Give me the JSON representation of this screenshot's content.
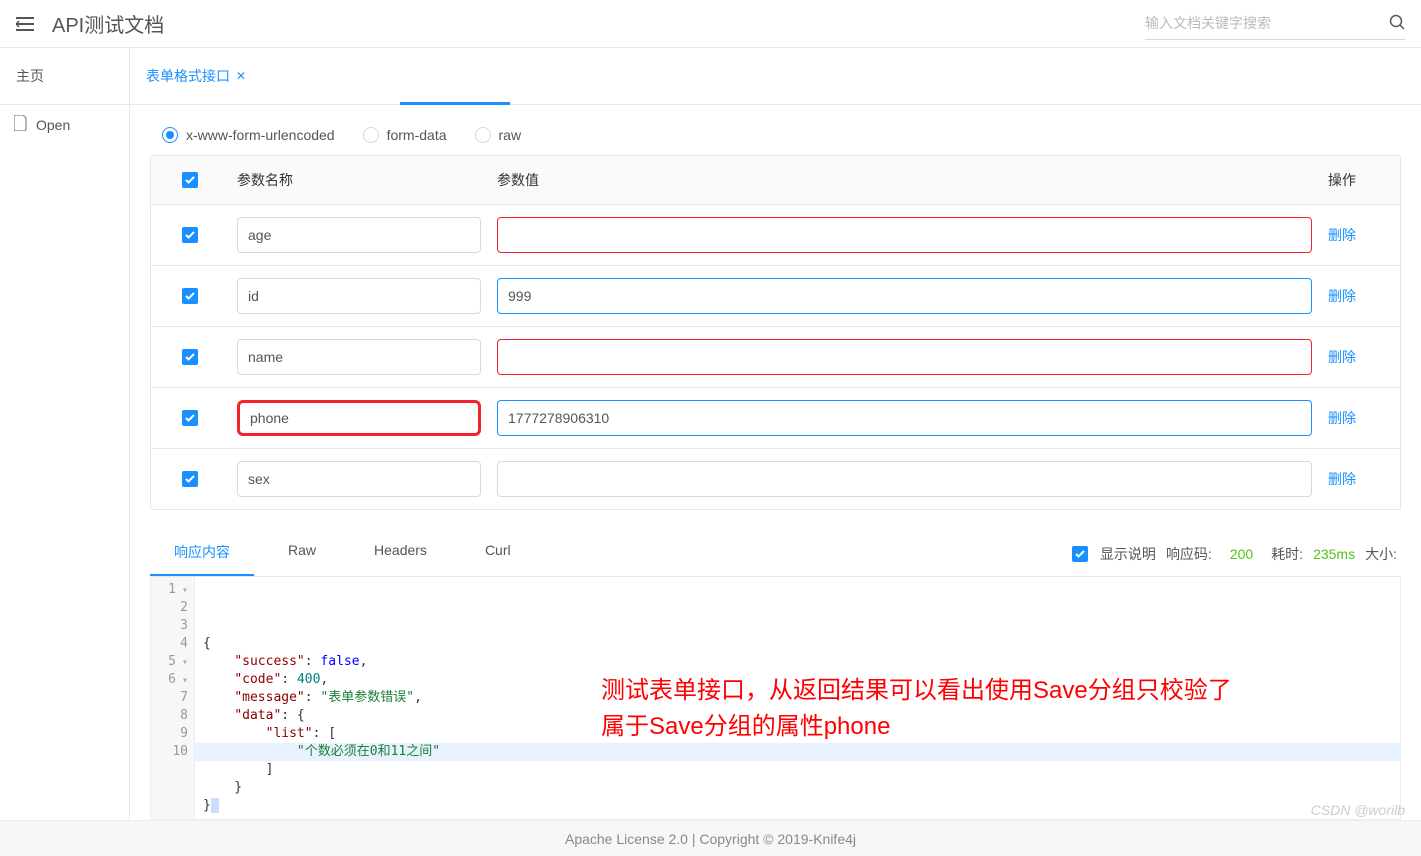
{
  "header": {
    "title": "API测试文档",
    "search_placeholder": "输入文档关键字搜索"
  },
  "sidebar": {
    "home_tab": "主页",
    "open_item": "Open"
  },
  "main_tabs": {
    "active_label": "表单格式接口"
  },
  "body_type": {
    "options": [
      "x-www-form-urlencoded",
      "form-data",
      "raw"
    ],
    "selected": "x-www-form-urlencoded"
  },
  "params_table": {
    "headers": {
      "name": "参数名称",
      "value": "参数值",
      "action": "操作"
    },
    "delete_label": "删除",
    "rows": [
      {
        "checked": true,
        "name": "age",
        "value": "",
        "value_state": "req-empty"
      },
      {
        "checked": true,
        "name": "id",
        "value": "999",
        "value_state": "filled"
      },
      {
        "checked": true,
        "name": "name",
        "value": "",
        "value_state": "req-empty"
      },
      {
        "checked": true,
        "name": "phone",
        "value": "1777278906310",
        "value_state": "filled",
        "name_state": "hl"
      },
      {
        "checked": true,
        "name": "sex",
        "value": "",
        "value_state": ""
      }
    ]
  },
  "response": {
    "tabs": [
      "响应内容",
      "Raw",
      "Headers",
      "Curl"
    ],
    "active_tab": "响应内容",
    "show_desc_label": "显示说明",
    "code_label": "响应码:",
    "code_value": "200",
    "time_label": "耗时:",
    "time_value": "235ms",
    "size_label": "大小:",
    "json": {
      "success": false,
      "code": 400,
      "message": "表单参数错误",
      "data": {
        "list": [
          "个数必须在0和11之间"
        ]
      }
    }
  },
  "annotation": {
    "line1": "测试表单接口，从返回结果可以看出使用Save分组只校验了",
    "line2": "属于Save分组的属性phone"
  },
  "footer": {
    "text": "Apache License 2.0 | Copyright © 2019-Knife4j"
  },
  "watermark": "CSDN @worilb"
}
